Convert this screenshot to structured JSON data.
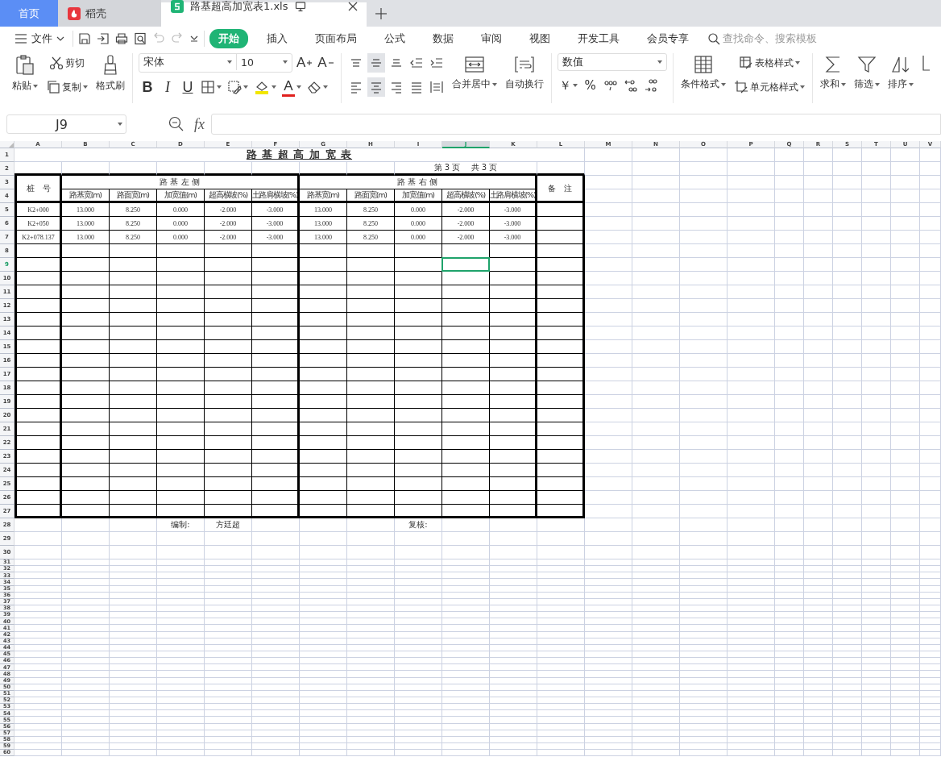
{
  "tabs": [
    {
      "label": "首页",
      "kind": "home",
      "selected": false
    },
    {
      "label": "稻壳",
      "kind": "docer",
      "selected": false
    },
    {
      "label": "路基超高加宽表1.xls",
      "kind": "sheet",
      "selected": true
    }
  ],
  "menu": {
    "file": "文件",
    "undo": {
      "disabled": true
    },
    "redo": {
      "disabled": true
    },
    "tabs": [
      {
        "label": "开始",
        "selected": true
      },
      {
        "label": "插入",
        "selected": false
      },
      {
        "label": "页面布局",
        "selected": false
      },
      {
        "label": "公式",
        "selected": false
      },
      {
        "label": "数据",
        "selected": false
      },
      {
        "label": "审阅",
        "selected": false
      },
      {
        "label": "视图",
        "selected": false
      },
      {
        "label": "开发工具",
        "selected": false
      },
      {
        "label": "会员专享",
        "selected": false
      }
    ],
    "search": {
      "placeholder": "查找命令、搜索模板"
    }
  },
  "ribbon": {
    "paste": "粘贴",
    "cut": "剪切",
    "copy": "复制",
    "format_painter": "格式刷",
    "font_name": "宋体",
    "font_size": "10",
    "grow_font": "A",
    "shrink_font": "A",
    "bold": "B",
    "italic": "I",
    "underline": "U",
    "font_color": "A",
    "vertical_align": [
      {
        "selected": false
      },
      {
        "selected": true
      },
      {
        "selected": false
      }
    ],
    "horizontal_align": [
      {
        "selected": false
      },
      {
        "selected": true
      },
      {
        "selected": false
      }
    ],
    "merge_center": "合并居中",
    "wrap_text": "自动换行",
    "number_format": "数值",
    "currency": "￥",
    "percent": "%",
    "conditional_format": "条件格式",
    "table_style": "表格样式",
    "cell_style": "单元格样式",
    "sum": "求和",
    "filter": "筛选",
    "sort": "排序"
  },
  "formula_bar": {
    "name_box": "J9",
    "function_label": "fx"
  },
  "sheet": {
    "columns": [
      {
        "label": "A",
        "selected": false
      },
      {
        "label": "B",
        "selected": false
      },
      {
        "label": "C",
        "selected": false
      },
      {
        "label": "D",
        "selected": false
      },
      {
        "label": "E",
        "selected": false
      },
      {
        "label": "F",
        "selected": false
      },
      {
        "label": "G",
        "selected": false
      },
      {
        "label": "H",
        "selected": false
      },
      {
        "label": "I",
        "selected": false
      },
      {
        "label": "J",
        "selected": true
      },
      {
        "label": "K",
        "selected": false
      },
      {
        "label": "L",
        "selected": false
      },
      {
        "label": "M",
        "selected": false
      },
      {
        "label": "N",
        "selected": false
      },
      {
        "label": "O",
        "selected": false
      },
      {
        "label": "P",
        "selected": false
      },
      {
        "label": "Q",
        "selected": false
      },
      {
        "label": "R",
        "selected": false
      },
      {
        "label": "S",
        "selected": false
      },
      {
        "label": "T",
        "selected": false
      },
      {
        "label": "U",
        "selected": false
      },
      {
        "label": "V",
        "selected": false
      }
    ],
    "rows": [
      {
        "label": "1",
        "selected": false
      },
      {
        "label": "2",
        "selected": false
      },
      {
        "label": "3",
        "selected": false
      },
      {
        "label": "4",
        "selected": false
      },
      {
        "label": "5",
        "selected": false
      },
      {
        "label": "6",
        "selected": false
      },
      {
        "label": "7",
        "selected": false
      },
      {
        "label": "8",
        "selected": false
      },
      {
        "label": "9",
        "selected": true
      },
      {
        "label": "10",
        "selected": false
      },
      {
        "label": "11",
        "selected": false
      },
      {
        "label": "12",
        "selected": false
      },
      {
        "label": "13",
        "selected": false
      },
      {
        "label": "14",
        "selected": false
      },
      {
        "label": "15",
        "selected": false
      },
      {
        "label": "16",
        "selected": false
      },
      {
        "label": "17",
        "selected": false
      },
      {
        "label": "18",
        "selected": false
      },
      {
        "label": "19",
        "selected": false
      },
      {
        "label": "20",
        "selected": false
      },
      {
        "label": "21",
        "selected": false
      },
      {
        "label": "22",
        "selected": false
      },
      {
        "label": "23",
        "selected": false
      },
      {
        "label": "24",
        "selected": false
      },
      {
        "label": "25",
        "selected": false
      },
      {
        "label": "26",
        "selected": false
      },
      {
        "label": "27",
        "selected": false
      },
      {
        "label": "28",
        "selected": false
      },
      {
        "label": "29",
        "selected": false
      },
      {
        "label": "30",
        "selected": false
      },
      {
        "label": "31",
        "selected": false
      },
      {
        "label": "32",
        "selected": false
      },
      {
        "label": "33",
        "selected": false
      },
      {
        "label": "34",
        "selected": false
      },
      {
        "label": "35",
        "selected": false
      },
      {
        "label": "36",
        "selected": false
      },
      {
        "label": "37",
        "selected": false
      },
      {
        "label": "38",
        "selected": false
      },
      {
        "label": "39",
        "selected": false
      },
      {
        "label": "40",
        "selected": false
      },
      {
        "label": "41",
        "selected": false
      },
      {
        "label": "42",
        "selected": false
      },
      {
        "label": "43",
        "selected": false
      },
      {
        "label": "44",
        "selected": false
      },
      {
        "label": "45",
        "selected": false
      },
      {
        "label": "46",
        "selected": false
      },
      {
        "label": "47",
        "selected": false
      },
      {
        "label": "48",
        "selected": false
      },
      {
        "label": "49",
        "selected": false
      },
      {
        "label": "50",
        "selected": false
      },
      {
        "label": "51",
        "selected": false
      },
      {
        "label": "52",
        "selected": false
      },
      {
        "label": "53",
        "selected": false
      },
      {
        "label": "54",
        "selected": false
      },
      {
        "label": "55",
        "selected": false
      },
      {
        "label": "56",
        "selected": false
      },
      {
        "label": "57",
        "selected": false
      },
      {
        "label": "58",
        "selected": false
      },
      {
        "label": "59",
        "selected": false
      },
      {
        "label": "60",
        "selected": false
      }
    ],
    "title": "路 基 超 高 加 宽 表",
    "page_info": "第 3 页　 共 3 页",
    "station_header": "桩　号",
    "left_group": "路 基 左 侧",
    "right_group": "路 基 右 侧",
    "remarks_header": "备　注",
    "subheaders": [
      "路基宽(m)",
      "路面宽(m)",
      "加宽值(m)",
      "超高横坡(%)",
      "土路肩横坡(%)",
      "路基宽(m)",
      "路面宽(m)",
      "加宽值(m)",
      "超高横坡(%)",
      "土路肩横坡(%)"
    ],
    "data_rows": [
      [
        "K2+000",
        "13.000",
        "8.250",
        "0.000",
        "-2.000",
        "-3.000",
        "13.000",
        "8.250",
        "0.000",
        "-2.000",
        "-3.000"
      ],
      [
        "K2+050",
        "13.000",
        "8.250",
        "0.000",
        "-2.000",
        "-3.000",
        "13.000",
        "8.250",
        "0.000",
        "-2.000",
        "-3.000"
      ],
      [
        "K2+078.137",
        "13.000",
        "8.250",
        "0.000",
        "-2.000",
        "-3.000",
        "13.000",
        "8.250",
        "0.000",
        "-2.000",
        "-3.000"
      ]
    ],
    "footer": [
      "编制:",
      "方廷超",
      "复核:"
    ]
  }
}
